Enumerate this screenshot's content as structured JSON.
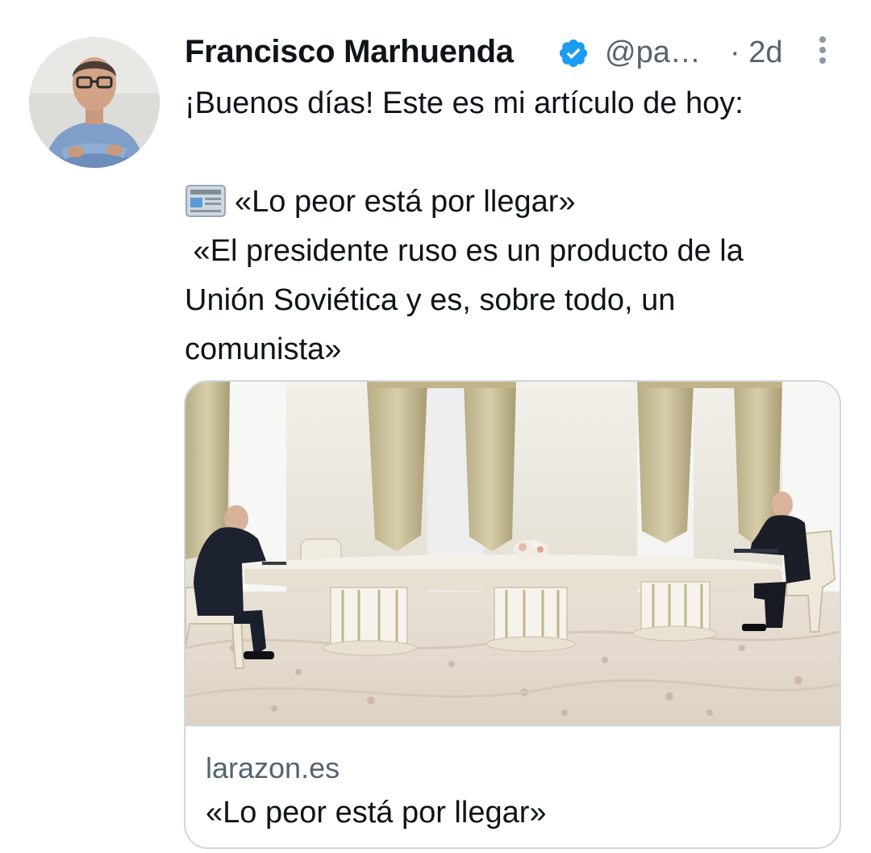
{
  "author": {
    "name": "Francisco Marhuenda",
    "handle": "@pa…",
    "time": "· 2d",
    "verified": true
  },
  "icons": {
    "verified": "verified-badge-icon",
    "more": "more-options-icon",
    "newspaper": "newspaper-emoji-icon"
  },
  "tweet": {
    "line1": "¡Buenos días! Este es mi artículo de hoy:",
    "line2": "«Lo peor está por llegar»",
    "line3": " «El presidente ruso es un producto de la",
    "line4": "Unión Soviética y es, sobre todo, un",
    "line5": "comunista»"
  },
  "card": {
    "domain": "larazon.es",
    "title": "«Lo peor está por llegar»"
  },
  "colors": {
    "text_primary": "#0f1419",
    "text_secondary": "#536471",
    "verified_blue": "#1d9bf0",
    "border": "#cfd9de"
  }
}
